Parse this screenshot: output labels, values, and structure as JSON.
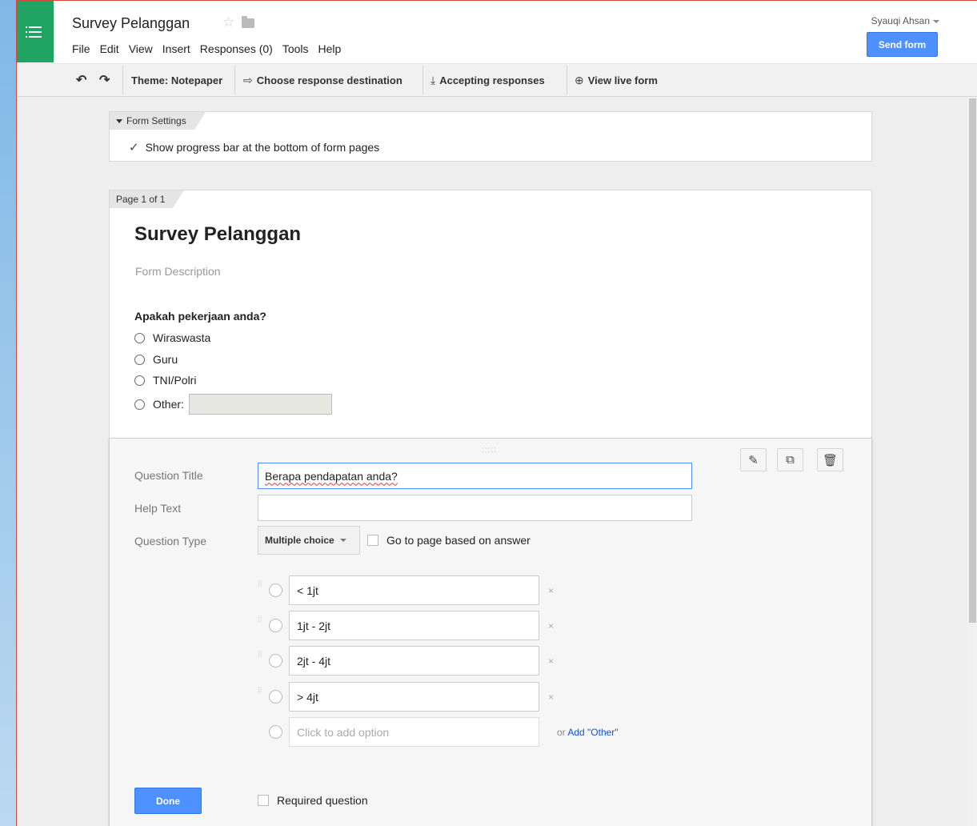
{
  "header": {
    "title": "Survey Pelanggan",
    "menu": [
      "File",
      "Edit",
      "View",
      "Insert",
      "Responses (0)",
      "Tools",
      "Help"
    ],
    "user": "Syauqi Ahsan",
    "send_label": "Send form"
  },
  "toolbar": {
    "theme": "Theme: Notepaper",
    "destination": "Choose response destination",
    "accepting": "Accepting responses",
    "live": "View live form"
  },
  "settings": {
    "tab": "Form Settings",
    "progress_label": "Show progress bar at the bottom of form pages",
    "progress_checked": true
  },
  "page": {
    "tab": "Page 1 of 1",
    "form_title": "Survey Pelanggan",
    "form_description": "Form Description",
    "question1": {
      "title": "Apakah pekerjaan anda?",
      "options": [
        "Wiraswasta",
        "Guru",
        "TNI/Polri",
        "Other:"
      ]
    }
  },
  "editor": {
    "drag_handle": ":::::",
    "labels": {
      "title": "Question Title",
      "help": "Help Text",
      "type": "Question Type"
    },
    "question_title": "Berapa pendapatan anda?",
    "help_text": "",
    "question_type": "Multiple choice",
    "goto_label": "Go to page based on answer",
    "choices": [
      "< 1jt",
      "1jt - 2jt",
      "2jt - 4jt",
      "> 4jt"
    ],
    "add_option_placeholder": "Click to add option",
    "or_text": "or",
    "add_other": "Add \"Other\"",
    "done_label": "Done",
    "required_label": "Required question"
  },
  "colors": {
    "brand_green": "#1fa463",
    "accent_blue": "#4d90fe",
    "link_blue": "#1155cc"
  }
}
